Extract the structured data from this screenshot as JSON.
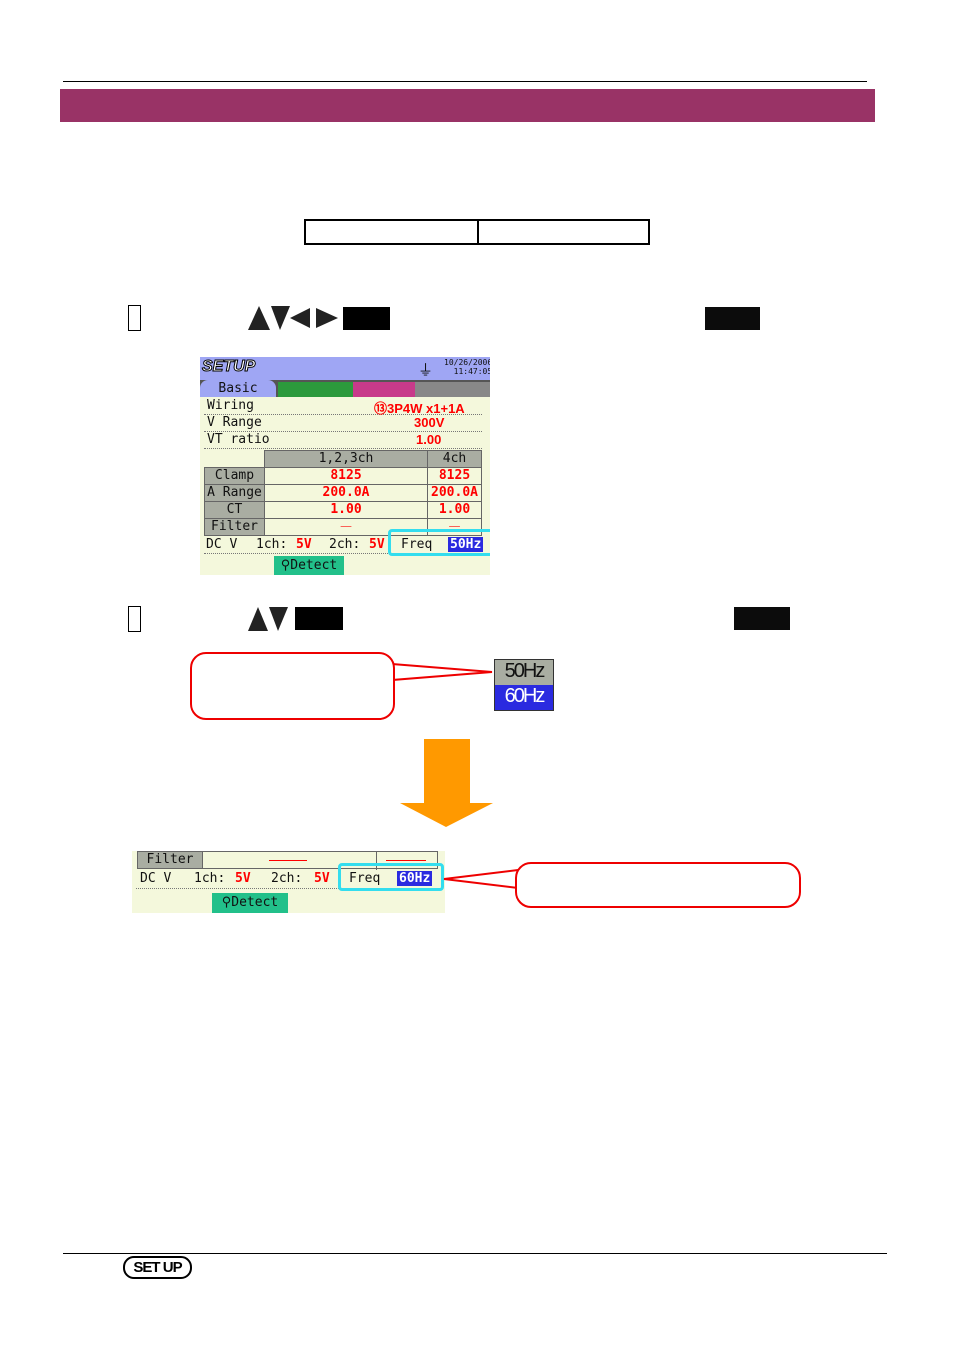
{
  "colors": {
    "header_bar": "#993366",
    "highlight_frame": "#33ddee",
    "value_red": "#ff0000",
    "selected_blue": "#2a2ae0",
    "detect_green": "#22c08a",
    "arrow_orange": "#ff9900"
  },
  "screen": {
    "title": "SETUP",
    "date": "10/26/2006",
    "time": "11:47:05",
    "tab": "Basic",
    "rows": [
      {
        "label": "Wiring",
        "value": "⑬3P4W x1+1A"
      },
      {
        "label": "V Range",
        "value": "300V"
      },
      {
        "label": "VT ratio",
        "value": "1.00"
      }
    ],
    "table": {
      "headers": [
        "1,2,3ch",
        "4ch"
      ],
      "rows": [
        {
          "label": "Clamp",
          "values": [
            "8125",
            "8125"
          ]
        },
        {
          "label": "A Range",
          "values": [
            "200.0A",
            "200.0A"
          ]
        },
        {
          "label": "CT ratio",
          "values": [
            "1.00",
            "1.00"
          ]
        },
        {
          "label": "Filter",
          "values": [
            "——",
            "——"
          ]
        }
      ]
    },
    "dcv": {
      "label": "DC V",
      "ch1_label": "1ch:",
      "ch1": "5V",
      "ch2_label": "2ch:",
      "ch2": "5V"
    },
    "freq": {
      "label": "Freq",
      "value": "50Hz"
    },
    "detect": "Detect"
  },
  "options": [
    "50Hz",
    "60Hz"
  ],
  "result": {
    "filter_label": "Filter",
    "dcv_label": "DC V",
    "ch1_label": "1ch:",
    "ch1": "5V",
    "ch2_label": "2ch:",
    "ch2": "5V",
    "freq_label": "Freq",
    "freq_value": "60Hz",
    "detect": "Detect"
  },
  "footer": {
    "badge": "SET UP"
  }
}
